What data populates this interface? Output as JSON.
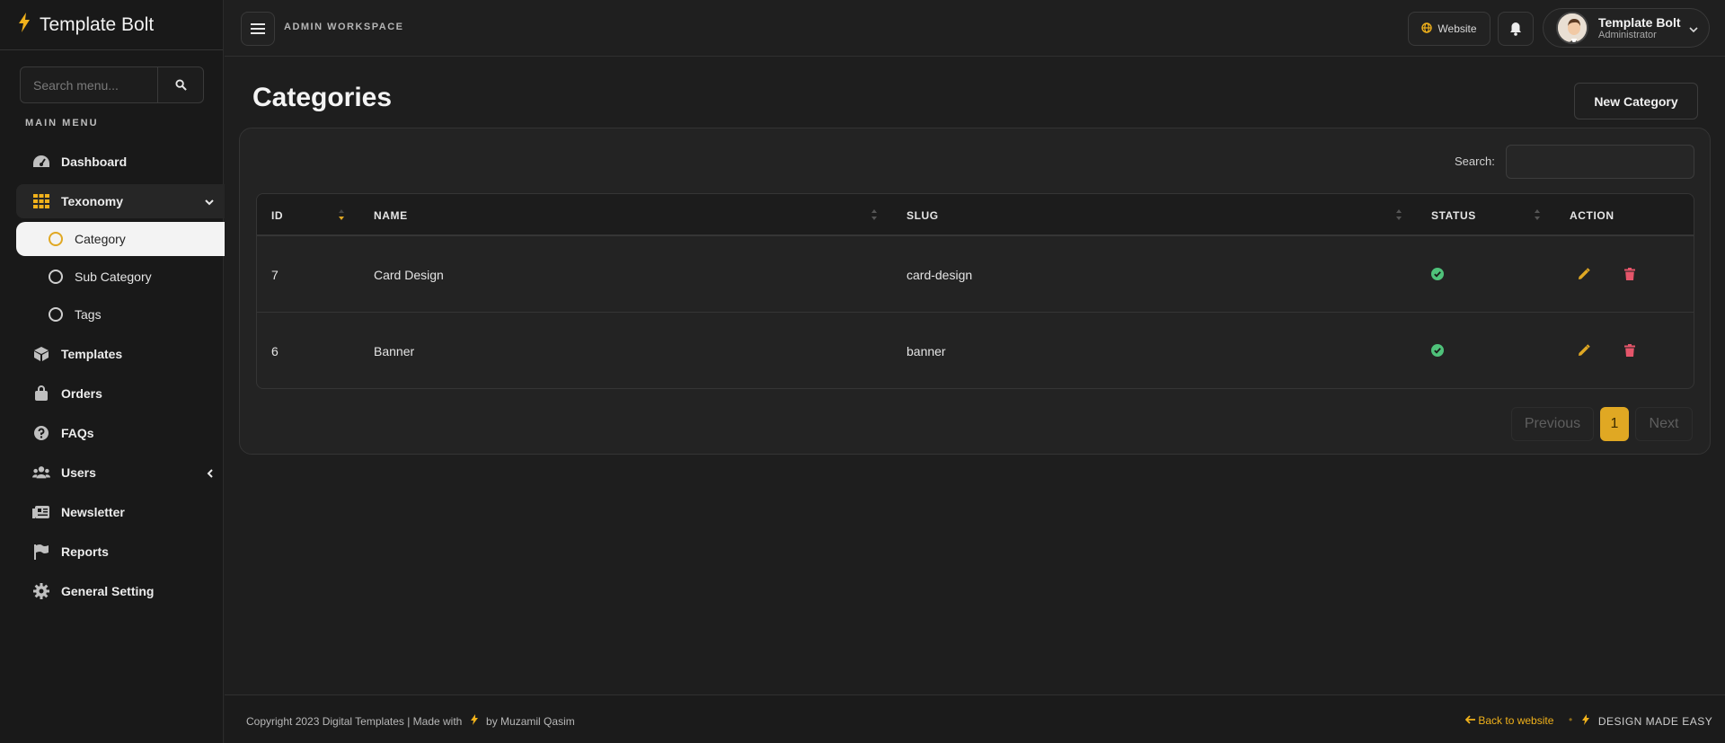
{
  "brand": {
    "name": "Template Bolt"
  },
  "sidebar": {
    "search_placeholder": "Search menu...",
    "menu_title": "MAIN MENU",
    "items": [
      {
        "label": "Dashboard",
        "icon": "dashboard-icon"
      },
      {
        "label": "Texonomy",
        "icon": "grid-icon"
      },
      {
        "label": "Templates",
        "icon": "cube-icon"
      },
      {
        "label": "Orders",
        "icon": "shopping-bag-icon"
      },
      {
        "label": "FAQs",
        "icon": "question-icon"
      },
      {
        "label": "Users",
        "icon": "users-icon"
      },
      {
        "label": "Newsletter",
        "icon": "newspaper-icon"
      },
      {
        "label": "Reports",
        "icon": "flag-icon"
      },
      {
        "label": "General Setting",
        "icon": "gear-icon"
      }
    ],
    "subitems": [
      {
        "label": "Category",
        "active": true
      },
      {
        "label": "Sub Category"
      },
      {
        "label": "Tags"
      }
    ]
  },
  "header": {
    "workspace": "ADMIN WORKSPACE",
    "website_label": "Website",
    "profile_name": "Template Bolt",
    "profile_role": "Administrator"
  },
  "main": {
    "title": "Categories",
    "new_button": "New Category",
    "search_label": "Search:",
    "columns": [
      "ID",
      "NAME",
      "SLUG",
      "STATUS",
      "ACTION"
    ],
    "rows": [
      {
        "id": "7",
        "name": "Card Design",
        "slug": "card-design",
        "status": "active"
      },
      {
        "id": "6",
        "name": "Banner",
        "slug": "banner",
        "status": "active"
      }
    ],
    "pagination": {
      "previous": "Previous",
      "current": "1",
      "next": "Next"
    }
  },
  "footer": {
    "copyright": "Copyright 2023 Digital Templates | Made with",
    "author": "by Muzamil Qasim",
    "back_link": "Back to website",
    "tagline": "DESIGN MADE EASY"
  },
  "colors": {
    "accent": "#e0a823",
    "success": "#4fc27a",
    "danger": "#e5556a"
  }
}
